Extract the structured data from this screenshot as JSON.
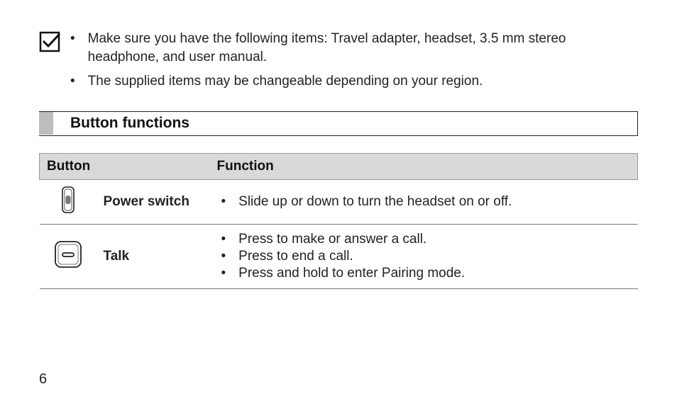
{
  "note": {
    "icon": "checkmark-box-icon",
    "items": [
      "Make sure you have the following items: Travel adapter, headset, 3.5 mm stereo headphone, and user manual.",
      "The supplied items may be changeable depending on your region."
    ]
  },
  "section_title": "Button functions",
  "table": {
    "header_button": "Button",
    "header_function": "Function",
    "rows": [
      {
        "icon": "power-switch-icon",
        "label": "Power switch",
        "functions": [
          "Slide up or down to turn the headset on or off."
        ]
      },
      {
        "icon": "talk-button-icon",
        "label": "Talk",
        "functions": [
          "Press to make or answer a call.",
          "Press to end a call.",
          "Press and hold to enter Pairing mode."
        ]
      }
    ]
  },
  "page_number": "6"
}
